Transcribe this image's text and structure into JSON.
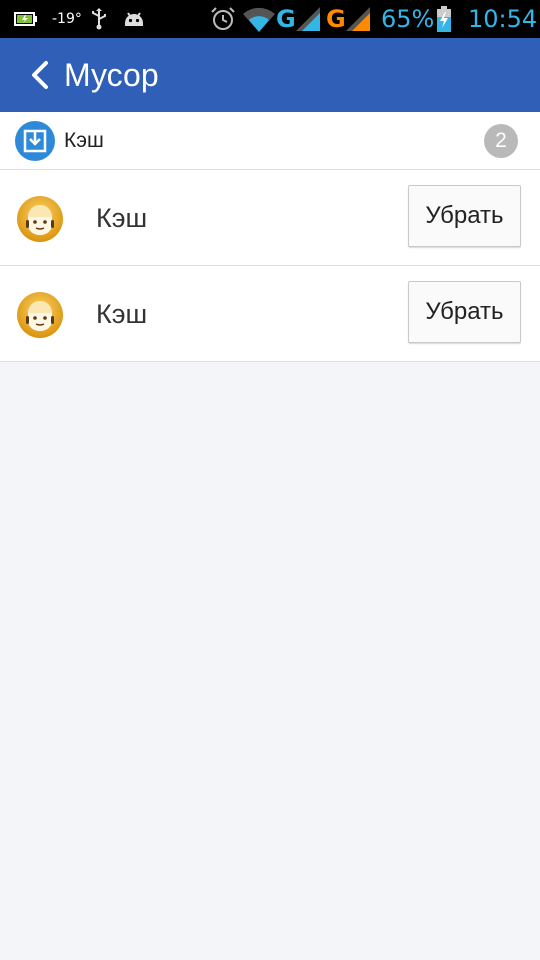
{
  "status_bar": {
    "temperature": "-19°",
    "battery_percent": "65%",
    "time": "10:54",
    "network_1": "G",
    "network_2": "G",
    "network_1_color": "#33b5e5",
    "network_2_color": "#ff8a00",
    "icons": [
      "battery-small-icon",
      "usb-icon",
      "android-icon",
      "alarm-icon",
      "wifi-icon",
      "signal-icon",
      "signal-icon",
      "battery-charging-icon"
    ]
  },
  "header": {
    "title": "Мусор",
    "color": "#2f5fb7"
  },
  "section": {
    "title": "Кэш",
    "count": "2",
    "icon": "download-box-icon"
  },
  "items": [
    {
      "label": "Кэш",
      "button_label": "Убрать",
      "icon": "robot-face-icon"
    },
    {
      "label": "Кэш",
      "button_label": "Убрать",
      "icon": "robot-face-icon"
    }
  ]
}
